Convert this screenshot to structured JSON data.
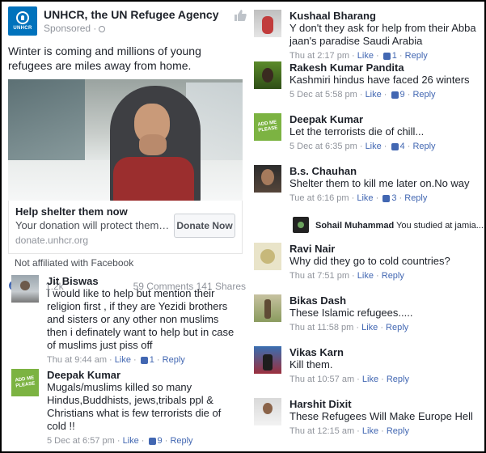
{
  "post": {
    "page_name": "UNHCR, the UN Refugee Agency",
    "logo_text": "UNHCR",
    "sponsored": "Sponsored",
    "text": "Winter is coming and millions of young refugees are miles away from home."
  },
  "ad": {
    "title": "Help shelter them now",
    "description": "Your donation will protect them…",
    "url": "donate.unhcr.org",
    "button": "Donate Now",
    "not_affiliated": "Not affiliated with Facebook"
  },
  "reactions": {
    "count": "1.2k",
    "stats": "59 Comments 141 Shares"
  },
  "avatar_text": "ADD ME PLEASE",
  "comments": [
    {
      "name": "Jit Biswas",
      "text": "I would like to help but mention their religion first , if they are Yezidi brothers and sisters or any other non muslims then i definately want to help but in case of muslims just piss off",
      "time": "Thu at 9:44 am",
      "like": "Like",
      "likes": "1",
      "reply": "Reply"
    },
    {
      "name": "Deepak Kumar",
      "text": "Mugals/muslims killed so many Hindus,Buddhists, jews,tribals ppl & Christians what is few terrorists die of cold !!",
      "time": "5 Dec at 6:57 pm",
      "like": "Like",
      "likes": "9",
      "reply": "Reply"
    },
    {
      "name": "Kushaal Bharang",
      "text": "Y don't they ask for help from their Abba jaan's paradise Saudi Arabia",
      "time": "Thu at 2:17 pm",
      "like": "Like",
      "likes": "1",
      "reply": "Reply"
    },
    {
      "name": "Rakesh Kumar Pandita",
      "text": "Kashmiri hindus have faced 26 winters",
      "time": "5 Dec at 5:58 pm",
      "like": "Like",
      "likes": "9",
      "reply": "Reply"
    },
    {
      "name": "Deepak Kumar",
      "text": "Let the terrorists die of chill...",
      "time": "5 Dec at 6:35 pm",
      "like": "Like",
      "likes": "4",
      "reply": "Reply"
    },
    {
      "name": "B.s. Chauhan",
      "text": "Shelter them to kill me later on.No way",
      "time": "Tue at 6:16 pm",
      "like": "Like",
      "likes": "3",
      "reply": "Reply"
    },
    {
      "name": "Sohail Muhammad",
      "text": "You studied at jamia..."
    },
    {
      "name": "Ravi Nair",
      "text": "Why did they go to cold countries?",
      "time": "Thu at 7:51 pm",
      "like": "Like",
      "reply": "Reply"
    },
    {
      "name": "Bikas Dash",
      "text": "These Islamic refugees.....",
      "time": "Thu at 11:58 pm",
      "like": "Like",
      "reply": "Reply"
    },
    {
      "name": "Vikas Karn",
      "text": "Kill them.",
      "time": "Thu at 10:57 am",
      "like": "Like",
      "reply": "Reply"
    },
    {
      "name": "Harshit Dixit",
      "text": "These Refugees Will Make Europe Hell",
      "time": "Thu at 12:15 am",
      "like": "Like",
      "reply": "Reply"
    }
  ],
  "colors": {
    "facebook_blue": "#4267b2",
    "unhcr_blue": "#0072bc",
    "meta_gray": "#90949c"
  }
}
